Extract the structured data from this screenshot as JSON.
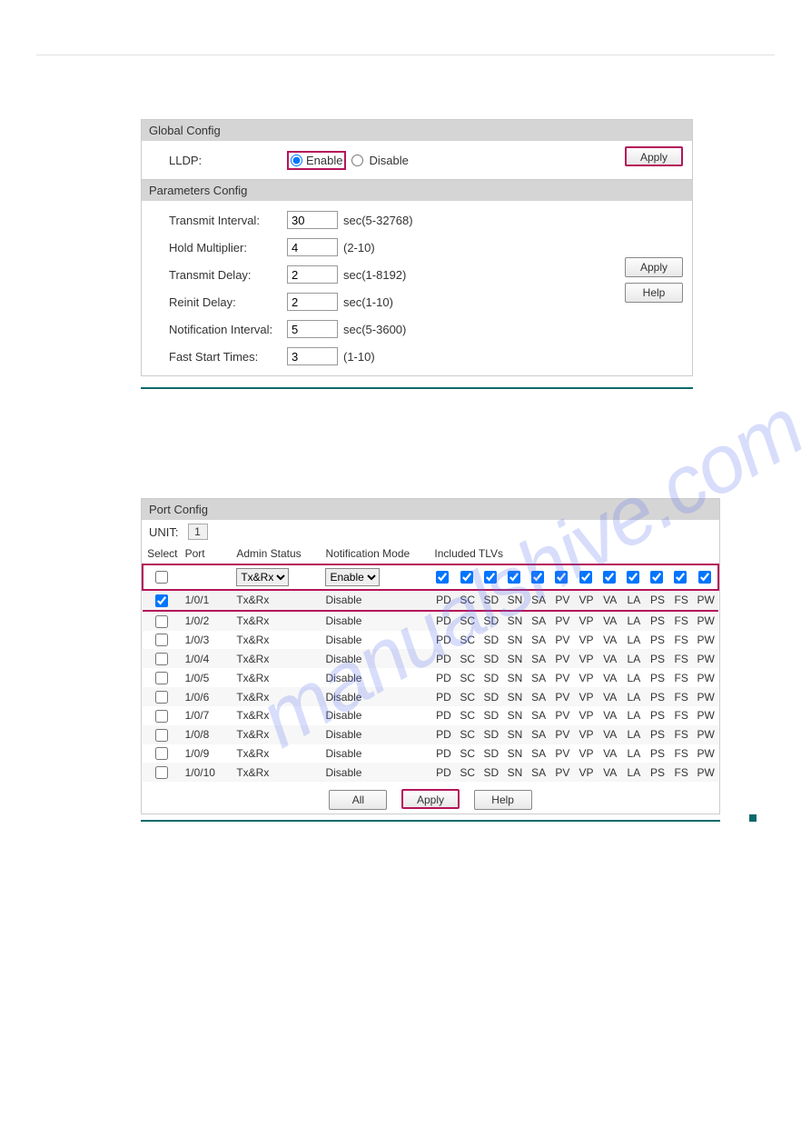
{
  "global": {
    "title": "Global Config",
    "lldp_label": "LLDP:",
    "enable_label": "Enable",
    "disable_label": "Disable",
    "apply_label": "Apply"
  },
  "params": {
    "title": "Parameters Config",
    "apply_label": "Apply",
    "help_label": "Help",
    "rows": [
      {
        "label": "Transmit Interval:",
        "value": "30",
        "hint": "sec(5-32768)"
      },
      {
        "label": "Hold Multiplier:",
        "value": "4",
        "hint": "(2-10)"
      },
      {
        "label": "Transmit Delay:",
        "value": "2",
        "hint": "sec(1-8192)"
      },
      {
        "label": "Reinit Delay:",
        "value": "2",
        "hint": "sec(1-10)"
      },
      {
        "label": "Notification Interval:",
        "value": "5",
        "hint": "sec(5-3600)"
      },
      {
        "label": "Fast Start Times:",
        "value": "3",
        "hint": "(1-10)"
      }
    ]
  },
  "portconfig": {
    "title": "Port Config",
    "unit_label": "UNIT:",
    "unit_value": "1",
    "headers": {
      "select": "Select",
      "port": "Port",
      "admin": "Admin Status",
      "notif": "Notification Mode",
      "tlvs": "Included TLVs"
    },
    "control": {
      "admin_option": "Tx&Rx",
      "notif_option": "Enable"
    },
    "tlv_labels": [
      "PD",
      "SC",
      "SD",
      "SN",
      "SA",
      "PV",
      "VP",
      "VA",
      "LA",
      "PS",
      "FS",
      "PW"
    ],
    "rows": [
      {
        "selected": true,
        "port": "1/0/1",
        "admin": "Tx&Rx",
        "notif": "Disable"
      },
      {
        "selected": false,
        "port": "1/0/2",
        "admin": "Tx&Rx",
        "notif": "Disable"
      },
      {
        "selected": false,
        "port": "1/0/3",
        "admin": "Tx&Rx",
        "notif": "Disable"
      },
      {
        "selected": false,
        "port": "1/0/4",
        "admin": "Tx&Rx",
        "notif": "Disable"
      },
      {
        "selected": false,
        "port": "1/0/5",
        "admin": "Tx&Rx",
        "notif": "Disable"
      },
      {
        "selected": false,
        "port": "1/0/6",
        "admin": "Tx&Rx",
        "notif": "Disable"
      },
      {
        "selected": false,
        "port": "1/0/7",
        "admin": "Tx&Rx",
        "notif": "Disable"
      },
      {
        "selected": false,
        "port": "1/0/8",
        "admin": "Tx&Rx",
        "notif": "Disable"
      },
      {
        "selected": false,
        "port": "1/0/9",
        "admin": "Tx&Rx",
        "notif": "Disable"
      },
      {
        "selected": false,
        "port": "1/0/10",
        "admin": "Tx&Rx",
        "notif": "Disable"
      }
    ],
    "buttons": {
      "all": "All",
      "apply": "Apply",
      "help": "Help"
    }
  },
  "watermark_text": "manualshive.com"
}
